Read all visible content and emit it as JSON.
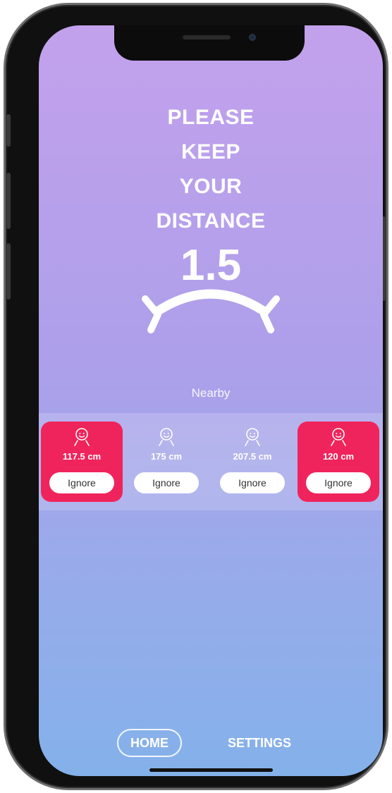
{
  "headline": {
    "lines": [
      "PLEASE",
      "KEEP",
      "YOUR",
      "DISTANCE"
    ]
  },
  "distance": {
    "value": "1.5"
  },
  "nearby": {
    "label": "Nearby"
  },
  "devices": [
    {
      "distance": "117.5 cm",
      "ignore_label": "Ignore",
      "alert": true
    },
    {
      "distance": "175 cm",
      "ignore_label": "Ignore",
      "alert": false
    },
    {
      "distance": "207.5 cm",
      "ignore_label": "Ignore",
      "alert": false
    },
    {
      "distance": "120 cm",
      "ignore_label": "Ignore",
      "alert": true
    }
  ],
  "nav": {
    "home_label": "HOME",
    "settings_label": "SETTINGS",
    "active": "home"
  },
  "colors": {
    "alert": "#f0245c",
    "gradient_top": "#c3a1ec",
    "gradient_bottom": "#84b1ea",
    "text": "#ffffff"
  },
  "icons": {
    "device": "person-face-icon",
    "distance": "distance-arc-icon"
  }
}
